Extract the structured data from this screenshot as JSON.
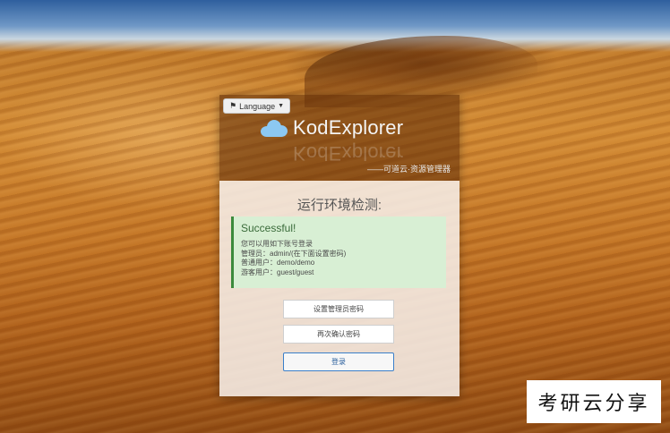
{
  "language_button": {
    "label": "Language",
    "icon": "flag-icon"
  },
  "app": {
    "name": "KodExplorer",
    "tagline": "——可道云·资源管理器",
    "logo_icon": "cloud-icon"
  },
  "check": {
    "title": "运行环境检测:",
    "status": "Successful!",
    "lines": [
      "您可以用如下账号登录",
      "管理员：admin/(在下面设置密码)",
      "普通用户：demo/demo",
      "游客用户：guest/guest"
    ]
  },
  "form": {
    "set_password_placeholder": "设置管理员密码",
    "confirm_password_placeholder": "再次确认密码",
    "login_label": "登录"
  },
  "watermark": "考研云分享",
  "colors": {
    "accent": "#3b7fc9",
    "success_bg": "#d8efd4",
    "success_border": "#3c8a3c"
  }
}
